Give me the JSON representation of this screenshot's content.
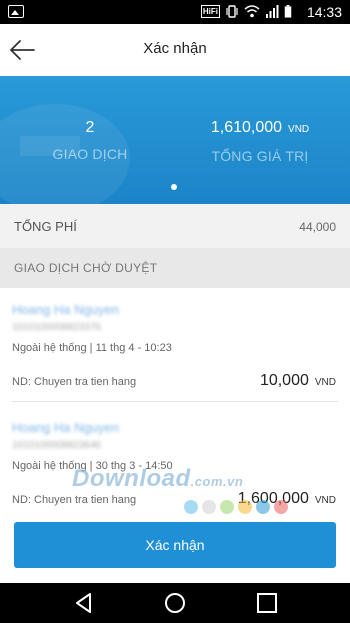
{
  "status_bar": {
    "time": "14:33",
    "hifi_label": "HiFi",
    "icons": [
      "image-icon",
      "hifi-icon",
      "vibrate-icon",
      "wifi-icon",
      "signal-icon",
      "battery-icon"
    ]
  },
  "header": {
    "title": "Xác nhận",
    "back_icon": "arrow-left-icon"
  },
  "summary": {
    "transactions_count": "2",
    "transactions_label": "GIAO DỊCH",
    "total_value": "1,610,000",
    "total_currency": "VND",
    "total_label": "TỔNG GIÁ TRỊ",
    "accent_color": "#1f8fd6"
  },
  "fee": {
    "label": "TỔNG PHÍ",
    "value": "44,000"
  },
  "pending": {
    "header": "GIAO DỊCH CHỜ DUYỆT",
    "items": [
      {
        "name": "Hoang Ha Nguyen",
        "account": "1010100008823376",
        "meta": "Ngoài hệ thống | 11 thg 4 - 10:23",
        "note": "ND: Chuyen tra tien hang",
        "amount": "10,000",
        "currency": "VND"
      },
      {
        "name": "Hoang Ha Nguyen",
        "account": "1010100008823646",
        "meta": "Ngoài hệ thống | 30 thg 3 - 14:50",
        "note": "ND: Chuyen tra tien hang",
        "amount": "1,600,000",
        "currency": "VND"
      }
    ]
  },
  "watermark": {
    "text": "Download",
    "suffix": ".com.vn"
  },
  "actions": {
    "confirm_label": "Xác nhận"
  },
  "nav": {
    "icons": [
      "back-triangle-icon",
      "home-circle-icon",
      "recents-square-icon"
    ]
  }
}
